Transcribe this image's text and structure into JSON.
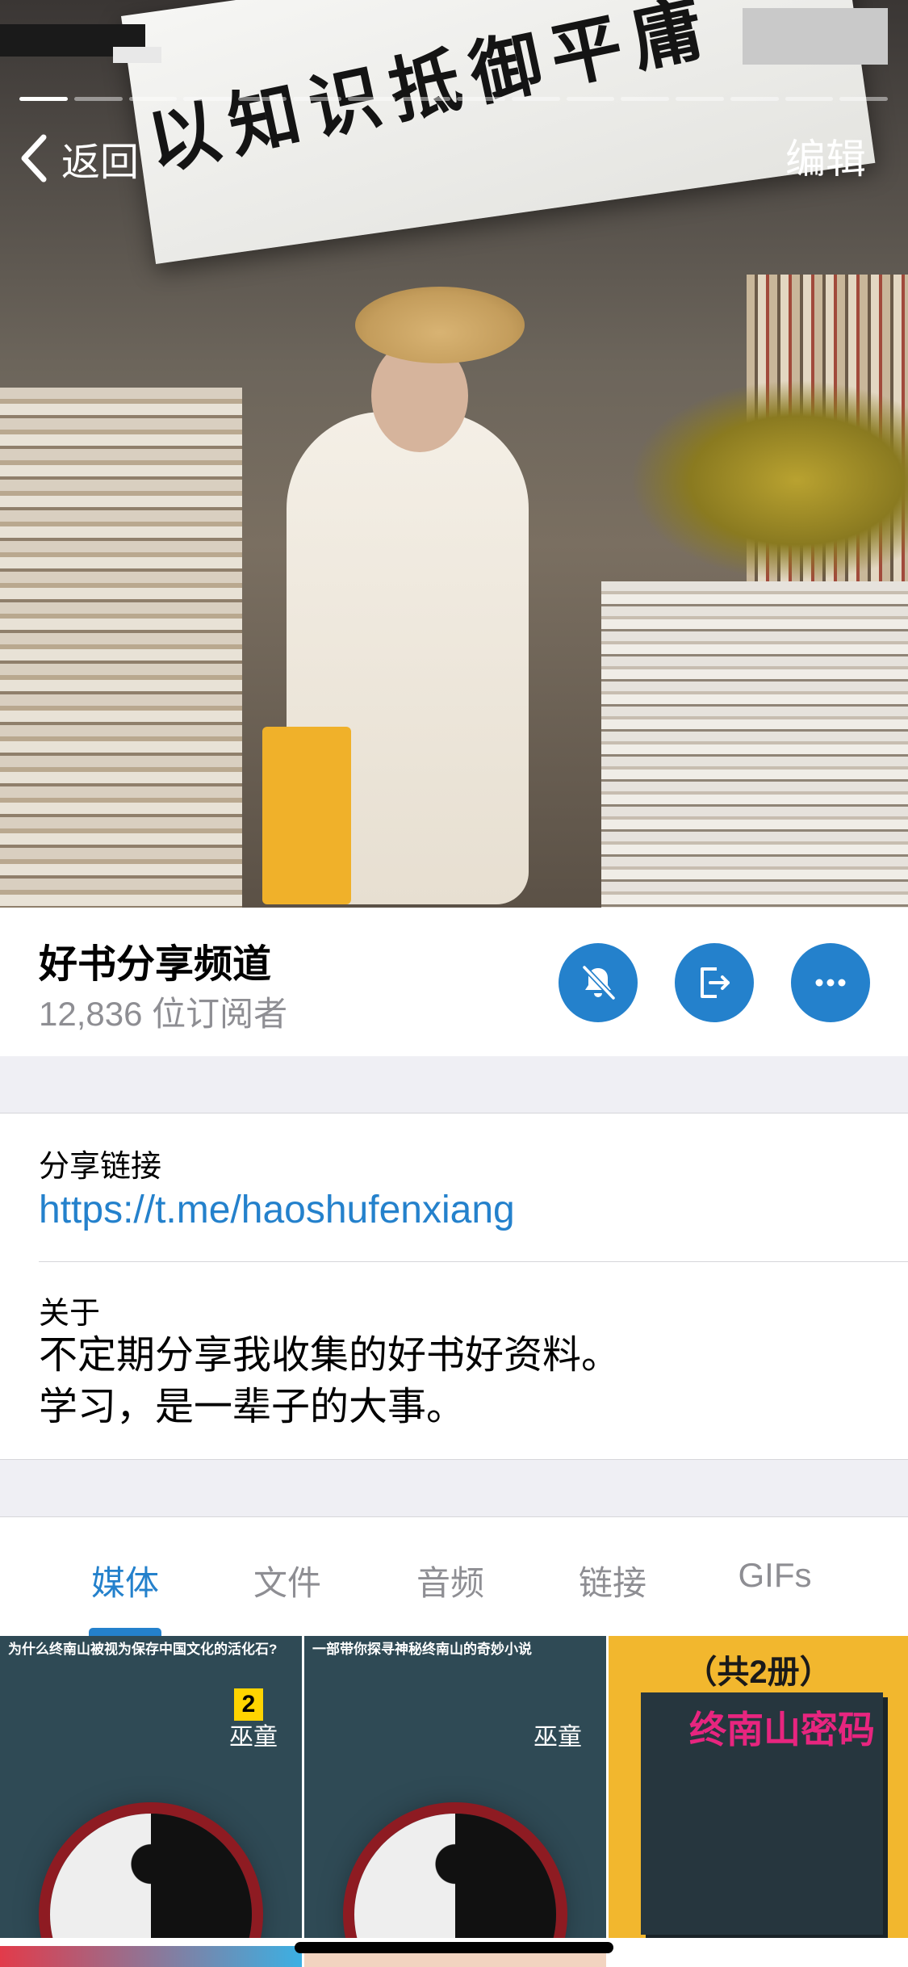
{
  "nav": {
    "back_label": "返回",
    "edit_label": "编辑"
  },
  "cover": {
    "sign_text": "以知识抵御平庸"
  },
  "channel": {
    "title": "好书分享频道",
    "subscribers": "12,836 位订阅者",
    "actions": [
      "mute-icon",
      "leave-icon",
      "more-icon"
    ]
  },
  "info": {
    "link_label": "分享链接",
    "link_value": "https://t.me/haoshufenxiang",
    "about_label": "关于",
    "about_text": "不定期分享我收集的好书好资料。\n学习，是一辈子的大事。"
  },
  "tabs": [
    {
      "label": "媒体",
      "active": true
    },
    {
      "label": "文件",
      "active": false
    },
    {
      "label": "音频",
      "active": false
    },
    {
      "label": "链接",
      "active": false
    },
    {
      "label": "GIFs",
      "active": false
    }
  ],
  "media": {
    "thumb1_blurb": "为什么终南山被视为保存中国文化的活化石?",
    "thumb1_volume": "2",
    "author": "巫童",
    "thumb2_blurb": "一部带你探寻神秘终南山的奇妙小说",
    "thumb3_set_label": "（共2册）",
    "thumb3_title": "终南山密码"
  },
  "colors": {
    "accent": "#2481cc",
    "secondary_text": "#8e8e93",
    "background": "#efeff4"
  }
}
